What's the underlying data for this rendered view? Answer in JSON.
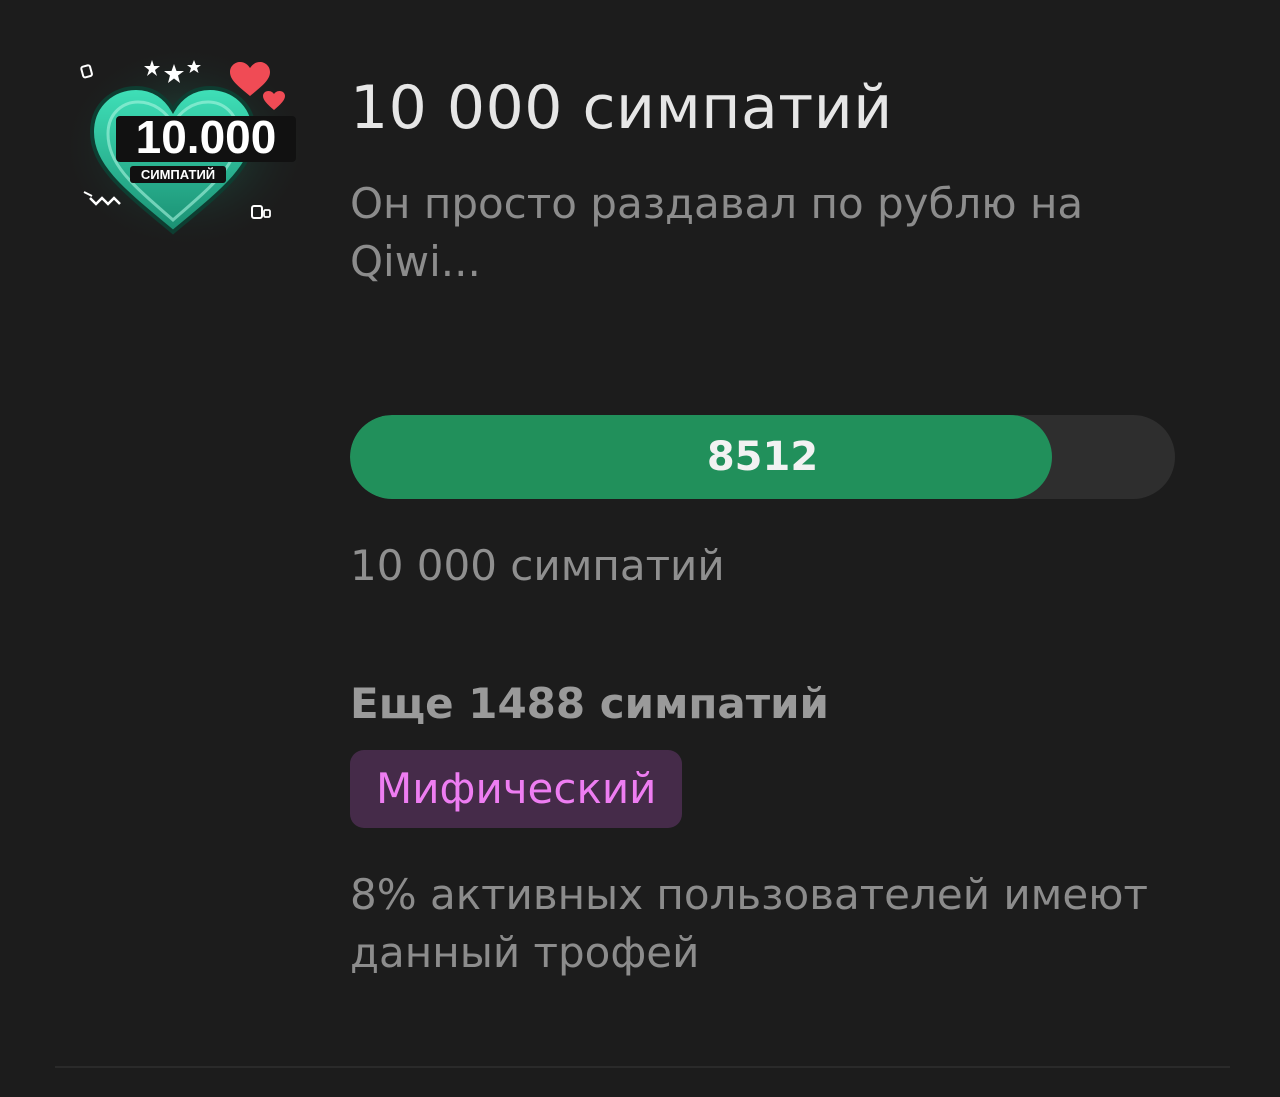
{
  "trophy": {
    "image_text_number": "10.000",
    "image_text_caption": "СИМПАТИЙ",
    "title": "10 000 симпатий",
    "description": "Он просто раздавал по рублю на Qiwi...",
    "progress": {
      "current_label": "8512",
      "current": 8512,
      "goal": 10000,
      "fraction": 0.8512
    },
    "goal_label": "10 000 симпатий",
    "remaining_label": "Еще 1488 симпатий",
    "rarity": "Мифический",
    "stat": "8% активных пользователей имеют данный трофей"
  },
  "colors": {
    "background": "#1c1c1c",
    "progress_fill": "#21905b",
    "progress_track": "#2e2e2e",
    "rarity_bg": "#452b49",
    "rarity_text": "#ee7df2",
    "badge_heart": "#2ec9a1"
  },
  "icons": [
    "heart-badge-icon",
    "star-icon",
    "red-heart-icon"
  ]
}
